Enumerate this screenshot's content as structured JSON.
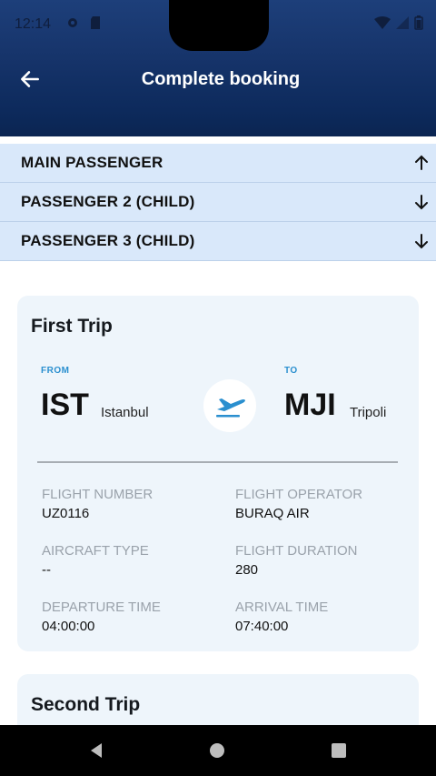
{
  "status_bar": {
    "time": "12:14"
  },
  "header": {
    "title": "Complete booking"
  },
  "accordion": [
    {
      "label": "MAIN PASSENGER",
      "state": "expanded"
    },
    {
      "label": "PASSENGER 2 (CHILD)",
      "state": "collapsed"
    },
    {
      "label": "PASSENGER 3 (CHILD)",
      "state": "collapsed"
    }
  ],
  "trips": [
    {
      "title": "First Trip",
      "from_label": "FROM",
      "from_code": "IST",
      "from_city": "Istanbul",
      "to_label": "TO",
      "to_code": "MJI",
      "to_city": "Tripoli",
      "details": {
        "flight_number_label": "FLIGHT NUMBER",
        "flight_number": "UZ0116",
        "flight_operator_label": "FLIGHT OPERATOR",
        "flight_operator": "BURAQ AIR",
        "aircraft_type_label": "AIRCRAFT TYPE",
        "aircraft_type": "--",
        "flight_duration_label": "FLIGHT DURATION",
        "flight_duration": "280",
        "departure_time_label": "DEPARTURE TIME",
        "departure_time": "04:00:00",
        "arrival_time_label": "ARRIVAL TIME",
        "arrival_time": "07:40:00"
      }
    },
    {
      "title": "Second Trip"
    }
  ],
  "colors": {
    "accent": "#2a8fcf",
    "header": "#0d2a5c",
    "accordion_bg": "#d9e8fa",
    "card_bg": "#eef5fb"
  },
  "icons": {
    "back": "arrow-left-icon",
    "expanded": "arrow-up-icon",
    "collapsed": "arrow-down-icon",
    "plane": "plane-takeoff-icon"
  }
}
